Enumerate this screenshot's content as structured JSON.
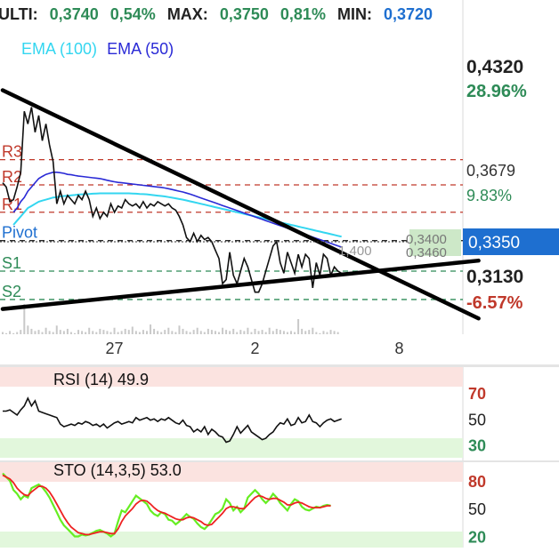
{
  "header": {
    "ulti_label": "ULTI:",
    "ulti_value": "0,3740",
    "ulti_change": "0,54%",
    "max_label": "MAX:",
    "max_value": "0,3750",
    "max_change": "0,81%",
    "min_label": "MIN:",
    "min_value": "0,3720"
  },
  "colors": {
    "green": "#2e8b57",
    "blue": "#1e6fd0",
    "red": "#c0392b",
    "ema100": "#33d6f0",
    "ema50": "#2a2ad6",
    "pivot": "#1e6fd0",
    "rsi_band": "#fbe3e0",
    "rsi_low_band": "#e2f7dc",
    "sto_k": "#66ee22",
    "sto_d": "#ee2222"
  },
  "legend": {
    "ema100": "EMA (100)",
    "ema50": "EMA (50)"
  },
  "price_scale": {
    "high_price": "0,4320",
    "high_pct": "28.96%",
    "mid_price": "0,3679",
    "mid_pct": "9.83%",
    "last_price": "0,3350",
    "low_price": "0,3130",
    "low_pct": "-6.57%"
  },
  "overlay_labels": {
    "crosshair_left": "1,400",
    "crosshair_right_top": "0,3400",
    "crosshair_right_bottom": "0,3460"
  },
  "chart_data": {
    "type": "line",
    "x_axis": {
      "tick_labels": [
        "27",
        "2",
        "8"
      ],
      "tick_index": [
        31,
        70,
        110
      ]
    },
    "price": {
      "ylim": [
        0.306,
        0.448
      ],
      "close": [
        0.378,
        0.376,
        0.369,
        0.37,
        0.376,
        0.383,
        0.412,
        0.406,
        0.414,
        0.402,
        0.41,
        0.398,
        0.406,
        0.396,
        0.388,
        0.368,
        0.374,
        0.368,
        0.372,
        0.37,
        0.368,
        0.372,
        0.37,
        0.374,
        0.37,
        0.362,
        0.366,
        0.361,
        0.364,
        0.362,
        0.368,
        0.364,
        0.367,
        0.366,
        0.37,
        0.368,
        0.367,
        0.368,
        0.366,
        0.369,
        0.366,
        0.368,
        0.367,
        0.369,
        0.368,
        0.367,
        0.368,
        0.366,
        0.365,
        0.362,
        0.358,
        0.352,
        0.35,
        0.354,
        0.35,
        0.353,
        0.351,
        0.352,
        0.35,
        0.346,
        0.342,
        0.33,
        0.332,
        0.345,
        0.334,
        0.33,
        0.336,
        0.342,
        0.338,
        0.332,
        0.326,
        0.326,
        0.33,
        0.336,
        0.342,
        0.348,
        0.35,
        0.34,
        0.335,
        0.345,
        0.34,
        0.335,
        0.344,
        0.338,
        0.344,
        0.342,
        0.328,
        0.34,
        0.334,
        0.344,
        0.342,
        0.334,
        0.338,
        0.336,
        0.335
      ]
    },
    "ema100": {
      "start_index": 3,
      "values": [
        0.358,
        0.36,
        0.362,
        0.364,
        0.366,
        0.367,
        0.368,
        0.369,
        0.3695,
        0.37,
        0.3705,
        0.371,
        0.3712,
        0.3715,
        0.3717,
        0.3718,
        0.372,
        0.3722,
        0.3724,
        0.3725,
        0.3726,
        0.3727,
        0.3728,
        0.3729,
        0.373,
        0.373,
        0.373,
        0.373,
        0.373,
        0.373,
        0.373,
        0.373,
        0.373,
        0.3729,
        0.3728,
        0.3727,
        0.3726,
        0.3725,
        0.3723,
        0.3721,
        0.3719,
        0.3717,
        0.3715,
        0.3712,
        0.3709,
        0.3706,
        0.3703,
        0.37,
        0.3696,
        0.3692,
        0.3688,
        0.3684,
        0.368,
        0.3676,
        0.3672,
        0.3668,
        0.3664,
        0.366,
        0.3656,
        0.3652,
        0.3648,
        0.3644,
        0.364,
        0.3636,
        0.3632,
        0.3628,
        0.3624,
        0.362,
        0.3616,
        0.3612,
        0.3608,
        0.3604,
        0.36,
        0.3596,
        0.3592,
        0.3588,
        0.3584,
        0.358,
        0.3576,
        0.3572,
        0.3568,
        0.3564,
        0.356,
        0.3556,
        0.3552,
        0.3548,
        0.3544,
        0.354,
        0.3536,
        0.3532,
        0.3528,
        0.3524
      ]
    },
    "ema50": {
      "start_index": 3,
      "values": [
        0.364,
        0.366,
        0.369,
        0.371,
        0.374,
        0.376,
        0.378,
        0.38,
        0.381,
        0.382,
        0.3825,
        0.383,
        0.383,
        0.3828,
        0.3825,
        0.382,
        0.3818,
        0.3815,
        0.3812,
        0.381,
        0.3808,
        0.3806,
        0.3804,
        0.3802,
        0.38,
        0.3796,
        0.3792,
        0.3788,
        0.3785,
        0.3782,
        0.378,
        0.3778,
        0.3776,
        0.3774,
        0.3772,
        0.377,
        0.3768,
        0.3766,
        0.3764,
        0.3762,
        0.376,
        0.3758,
        0.3755,
        0.3752,
        0.3748,
        0.3744,
        0.374,
        0.3736,
        0.3731,
        0.3726,
        0.372,
        0.3714,
        0.3708,
        0.3702,
        0.3696,
        0.369,
        0.3684,
        0.3678,
        0.3672,
        0.3666,
        0.366,
        0.3654,
        0.3648,
        0.3642,
        0.3636,
        0.363,
        0.3624,
        0.3618,
        0.3612,
        0.3606,
        0.36,
        0.3594,
        0.3588,
        0.3582,
        0.3576,
        0.357,
        0.3564,
        0.3558,
        0.3552,
        0.3546,
        0.354,
        0.3534,
        0.3528,
        0.3522,
        0.3516,
        0.351,
        0.3504,
        0.3498,
        0.3492,
        0.3486,
        0.348,
        0.3474
      ]
    },
    "pivot_levels": [
      {
        "name": "R3",
        "value": 0.389
      },
      {
        "name": "R2",
        "value": 0.377
      },
      {
        "name": "R1",
        "value": 0.364
      },
      {
        "name": "Pivot",
        "value": 0.3505
      },
      {
        "name": "S1",
        "value": 0.336
      },
      {
        "name": "S2",
        "value": 0.3225
      }
    ],
    "trendlines": [
      {
        "from": [
          0,
          0.422
        ],
        "to": [
          132,
          0.3135
        ]
      },
      {
        "from": [
          0,
          0.318
        ],
        "to": [
          132,
          0.341
        ]
      }
    ],
    "volume": [
      2,
      1,
      3,
      1,
      2,
      4,
      28,
      8,
      5,
      3,
      4,
      2,
      6,
      3,
      2,
      8,
      4,
      3,
      5,
      2,
      1,
      4,
      3,
      2,
      6,
      3,
      2,
      5,
      4,
      3,
      2,
      6,
      2,
      3,
      5,
      4,
      7,
      3,
      2,
      4,
      3,
      9,
      5,
      3,
      2,
      4,
      6,
      3,
      2,
      8,
      5,
      3,
      2,
      4,
      6,
      3,
      2,
      5,
      4,
      3,
      2,
      6,
      4,
      3,
      5,
      2,
      4,
      3,
      6,
      2,
      5,
      3,
      4,
      2,
      6,
      3,
      5,
      4,
      3,
      2,
      3,
      2,
      14,
      5,
      3,
      4,
      6,
      2,
      1,
      3,
      2,
      4,
      3,
      2
    ],
    "rsi": {
      "label": "RSI (14) 49.9",
      "levels": [
        70,
        50,
        30
      ],
      "values": [
        56,
        56,
        57,
        55,
        53,
        57,
        60,
        66,
        60,
        64,
        56,
        55,
        54,
        53,
        52,
        51,
        46,
        44,
        45,
        46,
        45,
        47,
        46,
        48,
        47,
        45,
        46,
        44,
        46,
        43,
        45,
        47,
        48,
        46,
        47,
        48,
        47,
        51,
        49,
        50,
        51,
        49,
        50,
        48,
        50,
        49,
        51,
        49,
        47,
        46,
        49,
        45,
        44,
        40,
        42,
        40,
        44,
        38,
        42,
        40,
        37,
        36,
        32,
        33,
        38,
        44,
        39,
        42,
        45,
        40,
        38,
        36,
        34,
        35,
        38,
        40,
        44,
        47,
        46,
        50,
        45,
        46,
        51,
        47,
        48,
        53,
        48,
        47,
        44,
        47,
        49,
        50,
        48,
        49,
        50
      ]
    },
    "sto": {
      "label": "STO (14,3,5) 53.0",
      "levels": [
        80,
        50,
        20
      ],
      "k": [
        88,
        84,
        80,
        70,
        66,
        60,
        64,
        62,
        72,
        74,
        76,
        73,
        68,
        62,
        54,
        46,
        38,
        32,
        28,
        24,
        20,
        20,
        22,
        21,
        22,
        24,
        26,
        27,
        25,
        23,
        20,
        23,
        36,
        48,
        46,
        52,
        58,
        64,
        61,
        58,
        55,
        48,
        44,
        42,
        46,
        44,
        38,
        37,
        33,
        36,
        40,
        44,
        41,
        39,
        34,
        30,
        28,
        32,
        38,
        44,
        46,
        50,
        60,
        56,
        48,
        52,
        46,
        50,
        62,
        66,
        70,
        66,
        60,
        56,
        60,
        66,
        62,
        56,
        52,
        48,
        55,
        60,
        58,
        52,
        49,
        48,
        50,
        52,
        51,
        53,
        54,
        53
      ],
      "d": [
        86,
        84,
        82,
        78,
        72,
        68,
        65,
        64,
        68,
        71,
        74,
        74,
        72,
        68,
        62,
        55,
        48,
        41,
        35,
        30,
        27,
        24,
        23,
        22,
        22,
        23,
        24,
        25,
        25,
        24,
        23,
        23,
        28,
        36,
        42,
        46,
        50,
        55,
        58,
        59,
        58,
        55,
        51,
        48,
        46,
        45,
        43,
        41,
        39,
        38,
        38,
        40,
        41,
        40,
        38,
        36,
        33,
        32,
        33,
        37,
        41,
        45,
        50,
        52,
        52,
        51,
        50,
        50,
        54,
        58,
        62,
        64,
        63,
        61,
        60,
        61,
        61,
        59,
        57,
        54,
        54,
        56,
        57,
        56,
        54,
        52,
        51,
        51,
        51,
        52,
        53,
        53
      ]
    }
  }
}
